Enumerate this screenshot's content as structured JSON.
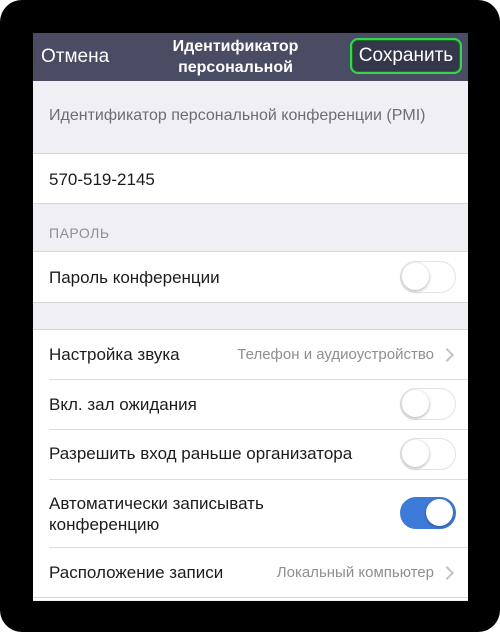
{
  "navbar": {
    "cancel_label": "Отмена",
    "title": "Идентификатор персональной конференции",
    "save_label": "Сохранить"
  },
  "pmi_section": {
    "label": "Идентификатор персональной конференции (PMI)",
    "value": "570-519-2145"
  },
  "password_section": {
    "label": "ПАРОЛЬ",
    "conference_password": {
      "label": "Пароль конференции",
      "enabled": false
    }
  },
  "options": {
    "audio": {
      "label": "Настройка звука",
      "value": "Телефон и аудиоустройство"
    },
    "waiting_room": {
      "label": "Вкл. зал ожидания",
      "enabled": false
    },
    "join_before_host": {
      "label": "Разрешить вход раньше организатора",
      "enabled": false
    },
    "auto_record": {
      "label": "Автоматически записывать конференцию",
      "enabled": true
    },
    "record_location": {
      "label": "Расположение записи",
      "value": "Локальный компьютер"
    }
  },
  "colors": {
    "navbar": "#4a4c63",
    "toggle_on": "#3e7bd9",
    "highlight": "#39d44f",
    "background": "#efeff4"
  },
  "icons": [
    "chevron-right-icon"
  ]
}
